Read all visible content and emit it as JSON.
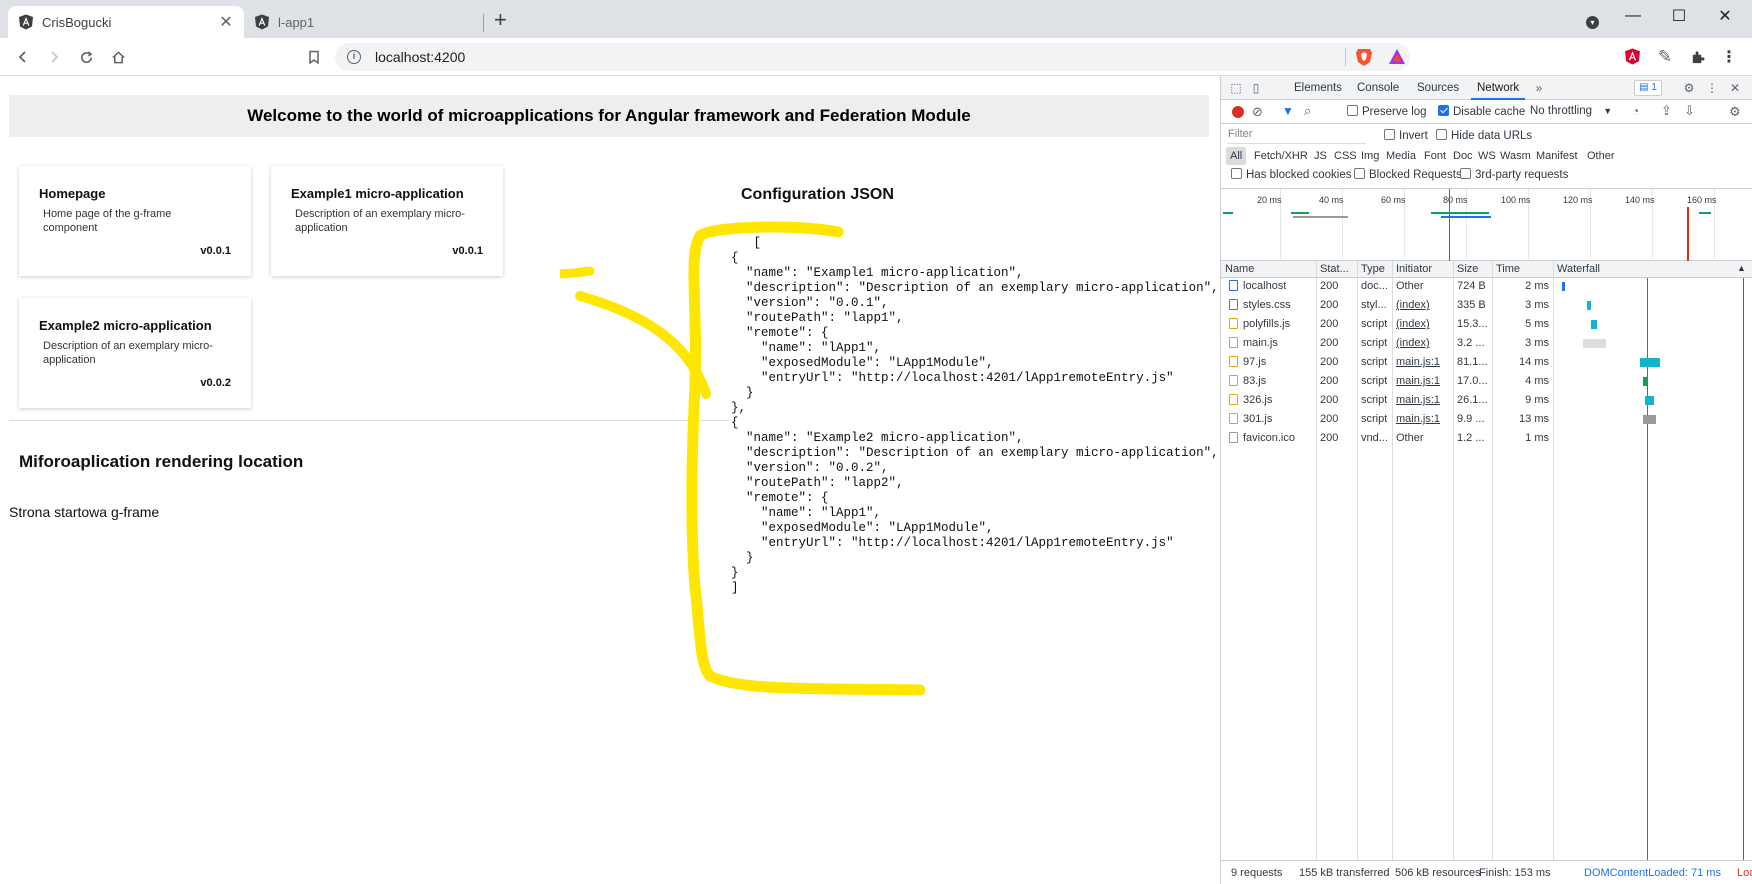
{
  "browser": {
    "tabs": [
      {
        "title": "CrisBogucki",
        "active": true
      },
      {
        "title": "l-app1",
        "active": false
      }
    ],
    "url": "localhost:4200"
  },
  "page": {
    "welcome": "Welcome to the world of microapplications for Angular framework and Federation Module",
    "cards": [
      {
        "title": "Homepage",
        "desc": "Home page of the g-frame component",
        "version": "v0.0.1"
      },
      {
        "title": "Example1 micro-application",
        "desc": "Description of an exemplary micro-application",
        "version": "v0.0.1"
      },
      {
        "title": "Example2 micro-application",
        "desc": "Description of an exemplary micro-application",
        "version": "v0.0.2"
      }
    ],
    "render_title": "Miforoaplication rendering location",
    "render_text": "Strona startowa g-frame",
    "config_title": "Configuration JSON",
    "config_json": "   [\n{\n  \"name\": \"Example1 micro-application\",\n  \"description\": \"Description of an exemplary micro-application\",\n  \"version\": \"0.0.1\",\n  \"routePath\": \"lapp1\",\n  \"remote\": {\n    \"name\": \"lApp1\",\n    \"exposedModule\": \"LApp1Module\",\n    \"entryUrl\": \"http://localhost:4201/lApp1remoteEntry.js\"\n  }\n},\n{\n  \"name\": \"Example2 micro-application\",\n  \"description\": \"Description of an exemplary micro-application\",\n  \"version\": \"0.0.2\",\n  \"routePath\": \"lapp2\",\n  \"remote\": {\n    \"name\": \"lApp1\",\n    \"exposedModule\": \"LApp1Module\",\n    \"entryUrl\": \"http://localhost:4201/lApp1remoteEntry.js\"\n  }\n}\n]",
    "annotation_color": "#ffe600"
  },
  "devtools": {
    "tabs": [
      "Elements",
      "Console",
      "Sources",
      "Network"
    ],
    "active_tab": "Network",
    "issues_count": "1",
    "toolbar": {
      "preserve_log": "Preserve log",
      "disable_cache": "Disable cache",
      "throttling": "No throttling"
    },
    "filter": {
      "placeholder": "Filter",
      "invert": "Invert",
      "hide_data_urls": "Hide data URLs"
    },
    "type_filters": [
      "All",
      "Fetch/XHR",
      "JS",
      "CSS",
      "Img",
      "Media",
      "Font",
      "Doc",
      "WS",
      "Wasm",
      "Manifest",
      "Other"
    ],
    "blocked": {
      "has_blocked_cookies": "Has blocked cookies",
      "blocked_requests": "Blocked Requests",
      "third_party": "3rd-party requests"
    },
    "overview_ticks": [
      "20 ms",
      "40 ms",
      "60 ms",
      "80 ms",
      "100 ms",
      "120 ms",
      "140 ms",
      "160 ms"
    ],
    "columns": [
      "Name",
      "Stat...",
      "Type",
      "Initiator",
      "Size",
      "Time",
      "Waterfall"
    ],
    "requests": [
      {
        "name": "localhost",
        "status": "200",
        "type": "doc...",
        "initiator": "Other",
        "size": "724 B",
        "time": "2 ms",
        "link": false
      },
      {
        "name": "styles.css",
        "status": "200",
        "type": "styl...",
        "initiator": "(index)",
        "size": "335 B",
        "time": "3 ms",
        "link": true
      },
      {
        "name": "polyfills.js",
        "status": "200",
        "type": "script",
        "initiator": "(index)",
        "size": "15.3...",
        "time": "5 ms",
        "link": true
      },
      {
        "name": "main.js",
        "status": "200",
        "type": "script",
        "initiator": "(index)",
        "size": "3.2 ...",
        "time": "3 ms",
        "link": true
      },
      {
        "name": "97.js",
        "status": "200",
        "type": "script",
        "initiator": "main.js:1",
        "size": "81.1...",
        "time": "14 ms",
        "link": true
      },
      {
        "name": "83.js",
        "status": "200",
        "type": "script",
        "initiator": "main.js:1",
        "size": "17.0...",
        "time": "4 ms",
        "link": true
      },
      {
        "name": "326.js",
        "status": "200",
        "type": "script",
        "initiator": "main.js:1",
        "size": "26.1...",
        "time": "9 ms",
        "link": true
      },
      {
        "name": "301.js",
        "status": "200",
        "type": "script",
        "initiator": "main.js:1",
        "size": "9.9 ...",
        "time": "13 ms",
        "link": true
      },
      {
        "name": "favicon.ico",
        "status": "200",
        "type": "vnd...",
        "initiator": "Other",
        "size": "1.2 ...",
        "time": "1 ms",
        "link": false
      }
    ],
    "status": {
      "requests": "9 requests",
      "transferred": "155 kB transferred",
      "resources": "506 kB resources",
      "finish": "Finish: 153 ms",
      "dcl": "DOMContentLoaded: 71 ms",
      "load": "Loa"
    },
    "colors": {
      "accent": "#1a73e8",
      "record": "#d93025",
      "dcl": "#1a73e8",
      "load": "#d93025"
    }
  }
}
